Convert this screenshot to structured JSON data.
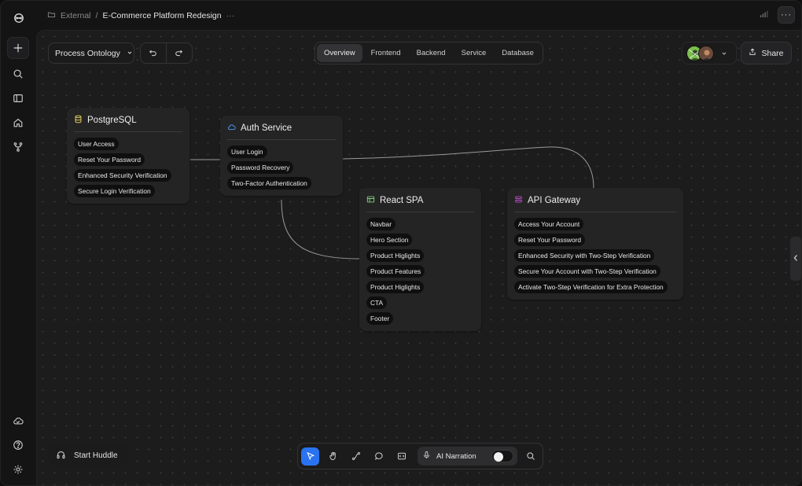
{
  "breadcrumb": {
    "parent": "External",
    "separator": "/",
    "current": "E-Commerce Platform Redesign",
    "more": "···"
  },
  "header": {
    "more_label": "···"
  },
  "toolbar_top": {
    "dropdown_label": "Process Ontology",
    "tabs": [
      {
        "label": "Overview",
        "active": true
      },
      {
        "label": "Frontend",
        "active": false
      },
      {
        "label": "Backend",
        "active": false
      },
      {
        "label": "Service",
        "active": false
      },
      {
        "label": "Database",
        "active": false
      }
    ],
    "share_label": "Share"
  },
  "nodes": {
    "postgresql": {
      "title": "PostgreSQL",
      "icon": "database-icon",
      "color": "#d4c35a",
      "items": [
        "User Access",
        "Reset Your Password",
        "Enhanced Security Verification",
        "Secure Login Verification"
      ]
    },
    "auth": {
      "title": "Auth Service",
      "icon": "cloud-icon",
      "color": "#4a90e2",
      "items": [
        "User Login",
        "Password Recovery",
        "Two-Factor Authentication"
      ]
    },
    "react": {
      "title": "React SPA",
      "icon": "layout-icon",
      "color": "#7fcf7a",
      "items": [
        "Navbar",
        "Hero Section",
        "Product Higlights",
        "Product Features",
        "Product Higlights",
        "CTA",
        "Footer"
      ]
    },
    "api": {
      "title": "API Gateway",
      "icon": "server-icon",
      "color": "#c34fd0",
      "items": [
        "Access Your Account",
        "Reset Your Password",
        "Enhanced Security with Two-Step Verification",
        "Secure Your Account with Two-Step Verification",
        "Activate Two-Step Verification for Extra Protection"
      ]
    }
  },
  "bottom": {
    "huddle_label": "Start Huddle",
    "narration_label": "AI Narration",
    "narration_on": false
  },
  "colors": {
    "accent": "#2a73f0"
  }
}
